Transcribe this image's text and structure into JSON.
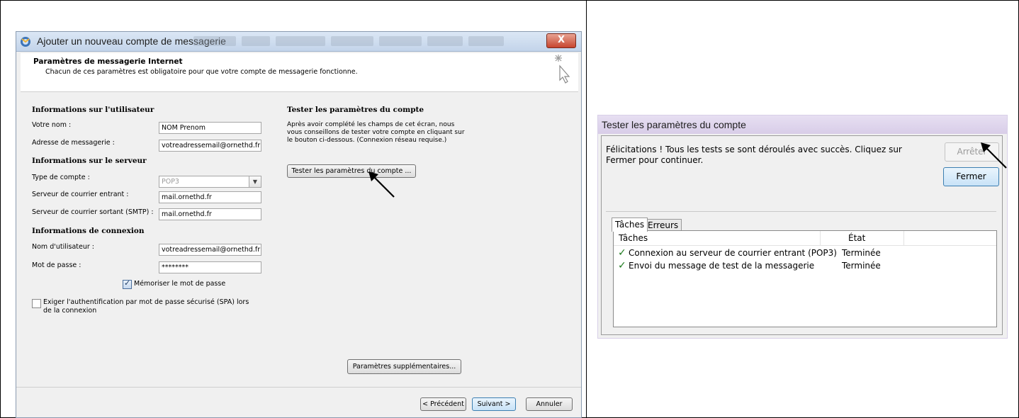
{
  "left_dialog": {
    "title": "Ajouter un nouveau compte de messagerie",
    "close_label": "X",
    "header_title": "Paramètres de messagerie Internet",
    "header_subtitle": "Chacun de ces paramètres est obligatoire pour que votre compte de messagerie fonctionne.",
    "user_section": "Informations sur l'utilisateur",
    "name_label": "Votre nom :",
    "name_value": "NOM Prenom",
    "email_label": "Adresse de messagerie :",
    "email_value": "votreadressemail@ornethd.fr",
    "server_section": "Informations sur le serveur",
    "account_type_label": "Type de compte :",
    "account_type_value": "POP3",
    "incoming_label": "Serveur de courrier entrant :",
    "incoming_value": "mail.ornethd.fr",
    "outgoing_label": "Serveur de courrier sortant (SMTP) :",
    "outgoing_value": "mail.ornethd.fr",
    "login_section": "Informations de connexion",
    "username_label": "Nom d'utilisateur :",
    "username_value": "votreadressemail@ornethd.fr",
    "password_label": "Mot de passe :",
    "password_value": "********",
    "remember_label": "Mémoriser le mot de passe",
    "remember_checked": true,
    "spa_label_line1": "Exiger l'authentification par mot de passe sécurisé (SPA) lors",
    "spa_label_line2": "de la connexion",
    "spa_checked": false,
    "test_section": "Tester les paramètres du compte",
    "test_info": "Après avoir complété les champs de cet écran, nous vous conseillons de tester votre compte en cliquant sur le bouton ci-dessous. (Connexion réseau requise.)",
    "test_button": "Tester les paramètres du compte ...",
    "more_settings_button": "Paramètres supplémentaires...",
    "back_button": "< Précédent",
    "next_button": "Suivant >",
    "cancel_button": "Annuler"
  },
  "right_dialog": {
    "title": "Tester les paramètres du compte",
    "message": "Félicitations ! Tous les tests se sont déroulés avec succès. Cliquez sur Fermer pour continuer.",
    "stop_button": "Arrêter",
    "close_button": "Fermer",
    "tabs": [
      {
        "label": "Tâches",
        "active": true
      },
      {
        "label": "Erreurs",
        "active": false
      }
    ],
    "columns": [
      "Tâches",
      "État"
    ],
    "rows": [
      {
        "task": "Connexion au serveur de courrier entrant (POP3)",
        "state": "Terminée"
      },
      {
        "task": "Envoi du message de test de la messagerie",
        "state": "Terminée"
      }
    ]
  },
  "colors": {
    "check_green": "#1e7a1e",
    "primary_button_border": "#3c7fb1",
    "close_red": "#c7452e"
  }
}
